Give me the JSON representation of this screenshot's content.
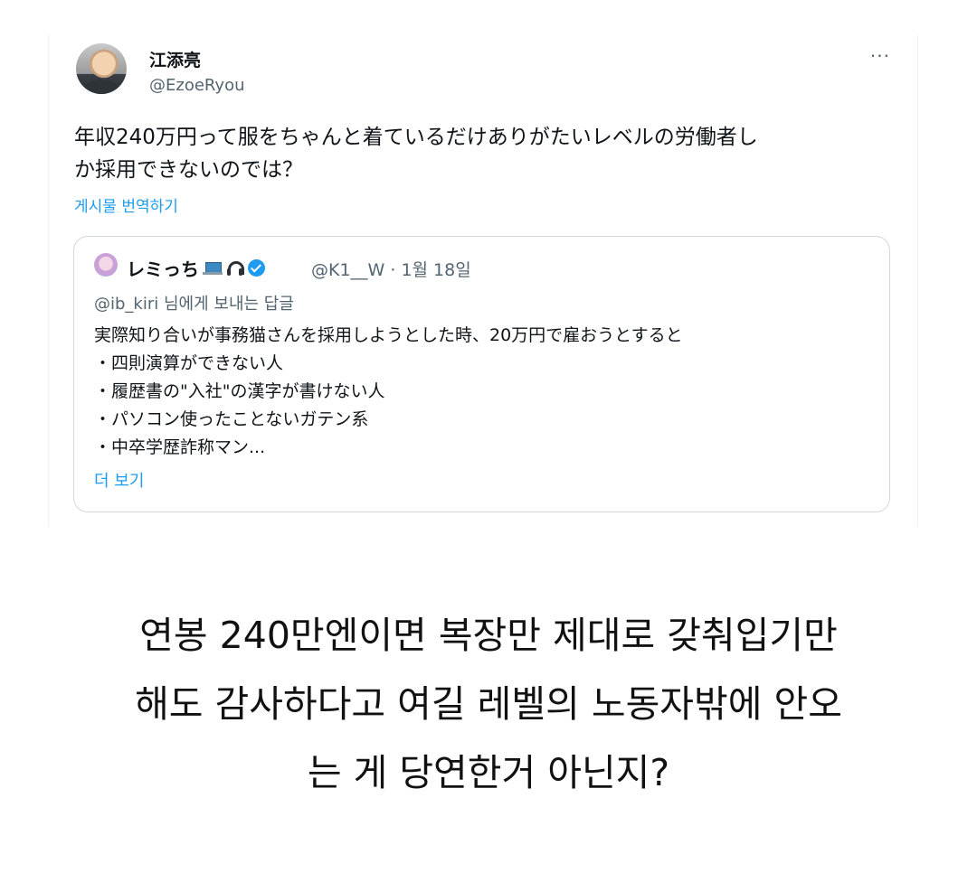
{
  "tweet": {
    "display_name": "江添亮",
    "handle": "@EzoeRyou",
    "more_label": "···",
    "text_lines": [
      "年収240万円って服をちゃんと着ているだけありがたいレベルの労働者し",
      "か採用できないのでは？"
    ],
    "translate_label": "게시물 번역하기",
    "quote": {
      "display_name": "レミっち",
      "meta": "@K1__W · 1월 18일",
      "reply_to_mention": "@ib_kiri",
      "reply_to_suffix": " 님에게 보내는 답글",
      "lines": [
        "実際知り合いが事務猫さんを採用しようとした時、20万円で雇おうとすると",
        "・四則演算ができない人",
        "・履歴書の\"入社\"の漢字が書けない人",
        "・パソコン使ったことないガテン系",
        "・中卒学歴詐称マン..."
      ],
      "more_label": "더 보기"
    }
  },
  "caption": {
    "lines": [
      "연봉 240만엔이면 복장만 제대로 갖춰입기만",
      "해도 감사하다고 여길 레벨의 노동자밖에 안오",
      "는 게 당연한거 아닌지?"
    ]
  },
  "colors": {
    "link": "#1d9bf0",
    "secondary_text": "#536471",
    "primary_text": "#0f1419",
    "border": "#cfd9de"
  }
}
